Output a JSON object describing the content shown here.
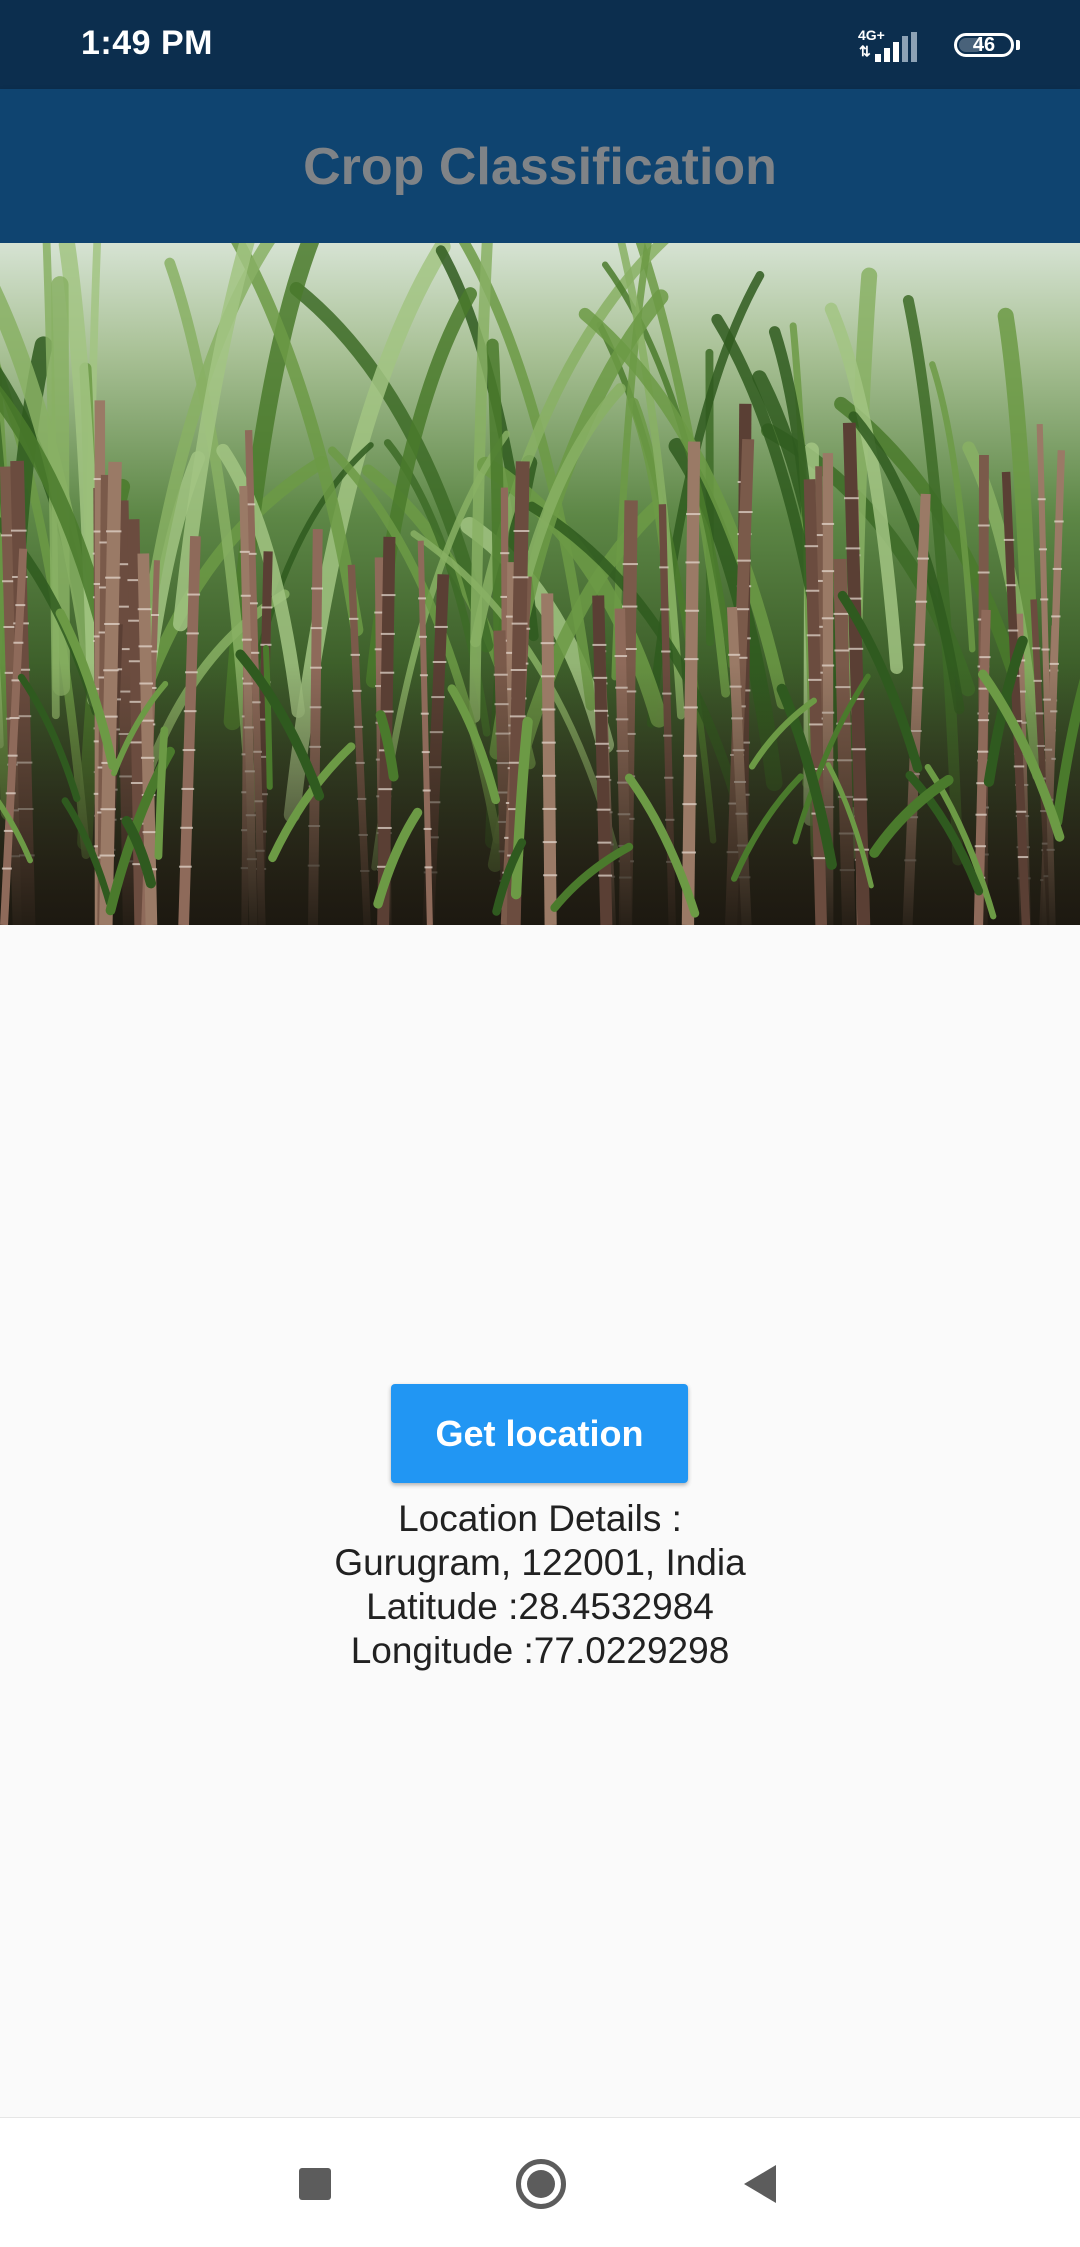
{
  "status_bar": {
    "time": "1:49 PM",
    "network": "4G+",
    "battery": "46",
    "icons": [
      "signal-icon",
      "battery-icon"
    ]
  },
  "app_bar": {
    "title": "Crop Classification"
  },
  "hero": {
    "image_name": "sugarcane-field-image"
  },
  "main": {
    "button_label": "Get location",
    "details": {
      "header": "Location Details :",
      "address": "Gurugram, 122001, India",
      "latitude": "Latitude :28.4532984",
      "longitude": "Longitude :77.0229298"
    }
  },
  "nav_bar": {
    "icons": [
      "recents-icon",
      "home-icon",
      "back-icon"
    ]
  },
  "colors": {
    "status_bar": "#0c2e4e",
    "app_bar": "#0f4470",
    "title_text": "#7f8387",
    "button": "#2196f3",
    "background": "#fafafa"
  }
}
